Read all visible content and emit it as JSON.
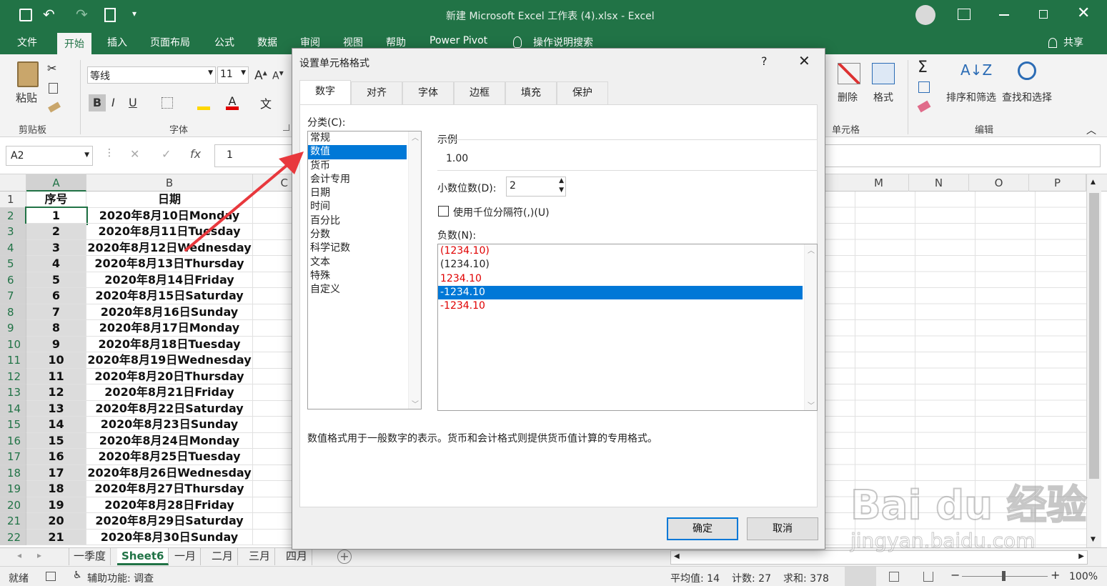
{
  "window": {
    "title": "新建 Microsoft Excel 工作表 (4).xlsx  -  Excel",
    "share": "共享"
  },
  "tabs": [
    "文件",
    "开始",
    "插入",
    "页面布局",
    "公式",
    "数据",
    "审阅",
    "视图",
    "帮助",
    "Power Pivot",
    "操作说明搜索"
  ],
  "ribbon": {
    "paste": "粘贴",
    "clipboard": "剪贴板",
    "font_name": "等线",
    "font_size": "11",
    "font_group": "字体",
    "bold": "B",
    "italic": "I",
    "underline": "U",
    "delete": "删除",
    "format": "格式",
    "cells_group": "单元格",
    "sort_filter": "排序和筛选",
    "find_select": "查找和选择",
    "edit_group": "编辑"
  },
  "formula_bar": {
    "name_box": "A2",
    "value": "1",
    "fx": "fx"
  },
  "columns_left": [
    "A",
    "B",
    "C"
  ],
  "columns_right": [
    "M",
    "N",
    "O",
    "P"
  ],
  "rows": [
    {
      "n": "1",
      "a": "序号",
      "b": "日期"
    },
    {
      "n": "2",
      "a": "1",
      "b": "2020年8月10日Monday"
    },
    {
      "n": "3",
      "a": "2",
      "b": "2020年8月11日Tuesday"
    },
    {
      "n": "4",
      "a": "3",
      "b": "2020年8月12日Wednesday"
    },
    {
      "n": "5",
      "a": "4",
      "b": "2020年8月13日Thursday"
    },
    {
      "n": "6",
      "a": "5",
      "b": "2020年8月14日Friday"
    },
    {
      "n": "7",
      "a": "6",
      "b": "2020年8月15日Saturday"
    },
    {
      "n": "8",
      "a": "7",
      "b": "2020年8月16日Sunday"
    },
    {
      "n": "9",
      "a": "8",
      "b": "2020年8月17日Monday"
    },
    {
      "n": "10",
      "a": "9",
      "b": "2020年8月18日Tuesday"
    },
    {
      "n": "11",
      "a": "10",
      "b": "2020年8月19日Wednesday"
    },
    {
      "n": "12",
      "a": "11",
      "b": "2020年8月20日Thursday"
    },
    {
      "n": "13",
      "a": "12",
      "b": "2020年8月21日Friday"
    },
    {
      "n": "14",
      "a": "13",
      "b": "2020年8月22日Saturday"
    },
    {
      "n": "15",
      "a": "14",
      "b": "2020年8月23日Sunday"
    },
    {
      "n": "16",
      "a": "15",
      "b": "2020年8月24日Monday"
    },
    {
      "n": "17",
      "a": "16",
      "b": "2020年8月25日Tuesday"
    },
    {
      "n": "18",
      "a": "17",
      "b": "2020年8月26日Wednesday"
    },
    {
      "n": "19",
      "a": "18",
      "b": "2020年8月27日Thursday"
    },
    {
      "n": "20",
      "a": "19",
      "b": "2020年8月28日Friday"
    },
    {
      "n": "21",
      "a": "20",
      "b": "2020年8月29日Saturday"
    },
    {
      "n": "22",
      "a": "21",
      "b": "2020年8月30日Sunday"
    }
  ],
  "sheet_tabs": [
    "一季度",
    "Sheet6",
    "一月",
    "二月",
    "三月",
    "四月"
  ],
  "status": {
    "ready": "就绪",
    "accessibility": "辅助功能: 调查",
    "average": "平均值: 14",
    "count": "计数: 27",
    "sum": "求和: 378",
    "zoom": "100%"
  },
  "dialog": {
    "title": "设置单元格格式",
    "help": "?",
    "tabs": [
      "数字",
      "对齐",
      "字体",
      "边框",
      "填充",
      "保护"
    ],
    "category_label": "分类(C):",
    "categories": [
      "常规",
      "数值",
      "货币",
      "会计专用",
      "日期",
      "时间",
      "百分比",
      "分数",
      "科学记数",
      "文本",
      "特殊",
      "自定义"
    ],
    "sample_label": "示例",
    "sample_value": "1.00",
    "decimal_label": "小数位数(D):",
    "decimal_value": "2",
    "thousands_label": "使用千位分隔符(,)(U)",
    "negative_label": "负数(N):",
    "negatives": [
      "(1234.10)",
      "(1234.10)",
      "1234.10",
      "-1234.10",
      "-1234.10"
    ],
    "description": "数值格式用于一般数字的表示。货币和会计格式则提供货币值计算的专用格式。",
    "ok": "确定",
    "cancel": "取消"
  },
  "watermark": {
    "brand": "Bai du 经验",
    "url": "jingyan.baidu.com"
  },
  "colors": {
    "excel_green": "#217346",
    "selection_blue": "#0078d7",
    "negative_red": "#e00000",
    "arrow_red": "#e8383d"
  }
}
